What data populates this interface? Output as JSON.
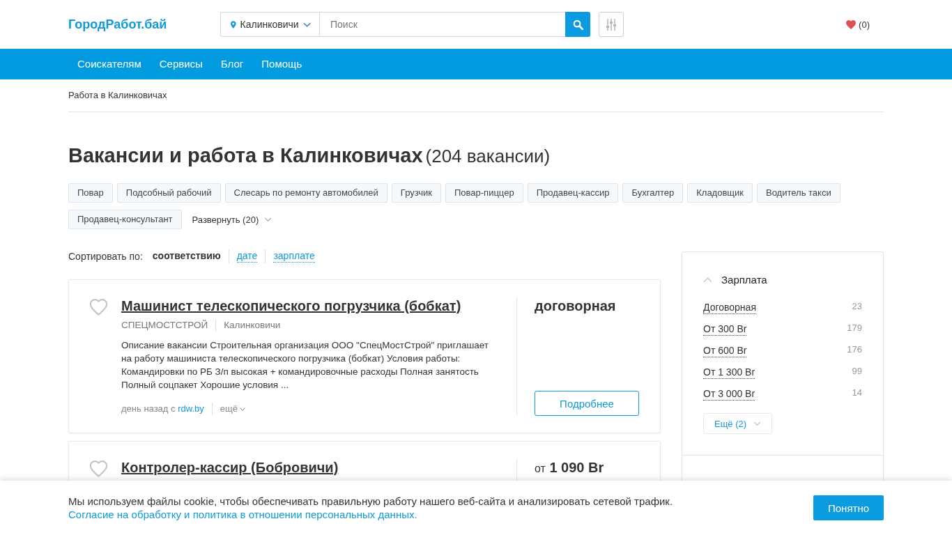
{
  "header": {
    "logo": "ГородРабот.бай",
    "city": "Калинковичи",
    "search": {
      "placeholder": "Поиск"
    },
    "favorites": "(0)"
  },
  "nav": [
    "Соискателям",
    "Сервисы",
    "Блог",
    "Помощь"
  ],
  "breadcrumb": [
    "Работа в Калинковичах"
  ],
  "heading": {
    "title": "Вакансии и работа в Калинковичах",
    "count": "(204 вакансии)"
  },
  "tags": {
    "items": [
      "Повар",
      "Подсобный рабочий",
      "Слесарь по ремонту автомобилей",
      "Грузчик",
      "Повар-пиццер",
      "Продавец-кассир",
      "Бухгалтер",
      "Кладовщик",
      "Водитель такси",
      "Продавец-консультант"
    ],
    "toggle": "Развернуть (20)"
  },
  "sort": {
    "label": "Сортировать по:",
    "options": [
      {
        "label": "соответствию",
        "selected": true
      },
      {
        "label": "дате",
        "selected": false
      },
      {
        "label": "зарплате",
        "selected": false
      }
    ]
  },
  "vacancies": [
    {
      "title": "Машинист телескопического погрузчика (бобкат)",
      "favorite": false,
      "company": "СПЕЦМОСТСТРОЙ",
      "city": "Калинковичи",
      "description": "Описание вакансии Строительная организация ООО \"СпецМостСтрой\" приглашает на работу машиниста телескопического погрузчика (бобкат) Условия работы: Командировки по РБ З/п высокая + командировочные расходы Полная занятость Полный соцпакет Хорошие условия ...",
      "posted": "день назад с",
      "source": "rdw.by",
      "more": "ещё",
      "salary": "договорная",
      "button": "Подробнее"
    },
    {
      "title": "Контролер-кассир (Бобровичи)",
      "favorite": false,
      "salary_prefix": "от",
      "salary": "1 090 Br"
    }
  ],
  "filters": [
    {
      "title": "Зарплата",
      "expanded": true,
      "options": [
        {
          "label": "Договорная",
          "count": "23"
        },
        {
          "label": "От 300 Br",
          "count": "179"
        },
        {
          "label": "От 600 Br",
          "count": "176"
        },
        {
          "label": "От 1 300 Br",
          "count": "99"
        },
        {
          "label": "От 3 000 Br",
          "count": "14"
        }
      ],
      "more": "Ещё (2)"
    }
  ],
  "cookie": {
    "text": "Мы используем файлы cookie, чтобы обеспечивать правильную работу нашего веб-сайта и анализировать сетевой трафик.",
    "link": "Согласие на обработку и политика в отношении персональных данных.",
    "button": "Понятно"
  }
}
